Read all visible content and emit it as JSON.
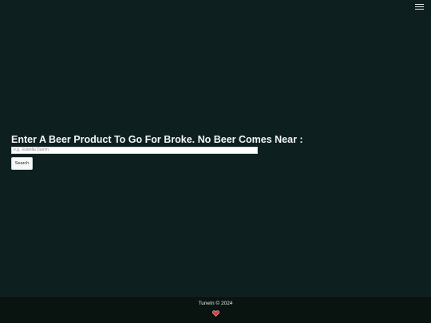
{
  "header": {
    "menu_icon": "hamburger-menu-icon"
  },
  "main": {
    "prompt": "Enter A Beer Product To Go For Broke. No Beer Comes Near :",
    "search": {
      "placeholder": "e.g., Estrella Damm",
      "value": "",
      "button_label": "Search"
    }
  },
  "footer": {
    "copyright": "TuneIn © 2024",
    "heart_icon": "heart-icon",
    "heart_color": "#e23a4a"
  },
  "colors": {
    "background": "#0e1f20",
    "footer_background": "#091410",
    "text": "#f2f5f5"
  }
}
